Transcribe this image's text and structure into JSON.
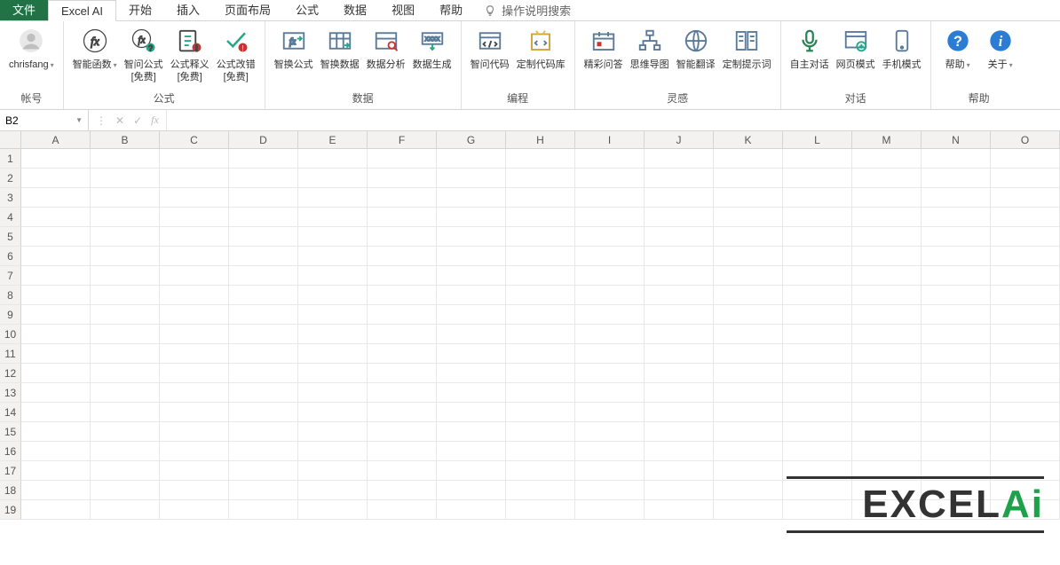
{
  "tabs": {
    "file": "文件",
    "active": "Excel AI",
    "others": [
      "开始",
      "插入",
      "页面布局",
      "公式",
      "数据",
      "视图",
      "帮助"
    ],
    "tell_me": "操作说明搜索"
  },
  "ribbon": {
    "account": {
      "user": "chrisfang",
      "group": "帐号"
    },
    "formula": {
      "group": "公式",
      "fn": "智能函数",
      "ask": "智问公式\n[免费]",
      "explain": "公式释义\n[免费]",
      "fix": "公式改错\n[免费]"
    },
    "data": {
      "group": "数据",
      "swap_formula": "智换公式",
      "swap_data": "智换数据",
      "analysis": "数据分析",
      "gen": "数据生成"
    },
    "code": {
      "group": "编程",
      "ask": "智问代码",
      "custom": "定制代码库"
    },
    "inspire": {
      "group": "灵感",
      "qa": "精彩问答",
      "mind": "思维导图",
      "translate": "智能翻译",
      "prompt": "定制提示词"
    },
    "dialog": {
      "group": "对话",
      "auto": "自主对话",
      "web": "网页模式",
      "mobile": "手机模式"
    },
    "help": {
      "group": "帮助",
      "help": "帮助",
      "about": "关于"
    }
  },
  "formula_bar": {
    "cell": "B2",
    "fx": "fx",
    "value": ""
  },
  "grid": {
    "cols": [
      "A",
      "B",
      "C",
      "D",
      "E",
      "F",
      "G",
      "H",
      "I",
      "J",
      "K",
      "L",
      "M",
      "N",
      "O"
    ],
    "rows": [
      "1",
      "2",
      "3",
      "4",
      "5",
      "6",
      "7",
      "8",
      "9",
      "10",
      "11",
      "12",
      "13",
      "14",
      "15",
      "16",
      "17",
      "18",
      "19"
    ]
  },
  "watermark": {
    "text_main": "EXCEL",
    "text_ai": "Ai"
  }
}
